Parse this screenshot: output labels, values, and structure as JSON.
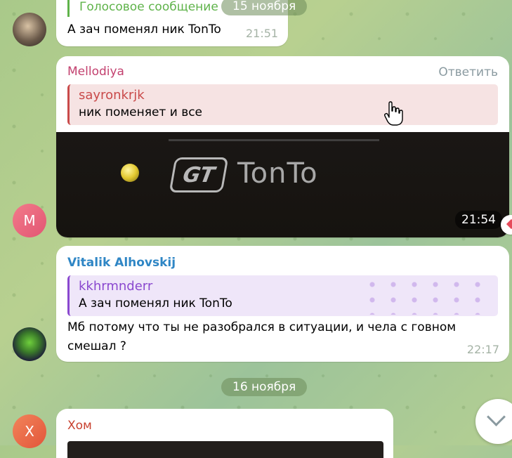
{
  "messages": {
    "prev": {
      "voice_label": "Голосовое сообщение",
      "text": "А зач поменял ник TonTo",
      "time": "21:51"
    },
    "m1": {
      "sender": "Mellodiya",
      "reply_action": "Ответить",
      "reply_name": "sayronkrjk",
      "reply_text": "ник поменяет и все",
      "image_text": "TonTo",
      "image_logo": "GT",
      "time": "21:54",
      "avatar_letter": "M"
    },
    "m2": {
      "sender": "Vitalik Alhovskij",
      "reply_name": "kkhrmnderr",
      "reply_text": "А зач поменял ник TonTo",
      "text_line1": "Мб потому что ты не разобрался в ситуации, и чела с говном",
      "text_line2": "смешал ?",
      "time": "22:17"
    },
    "m3": {
      "sender": "Хом",
      "avatar_letter": "Х"
    }
  },
  "dates": {
    "top": "15 ноября",
    "mid": "16 ноября"
  },
  "colors": {
    "mellodiya": "#c3416f",
    "vitalik": "#2f86c5",
    "hom": "#c8412f",
    "reply_red": "#c94a4a",
    "reply_purple": "#8a48cf",
    "voice_green": "#5fb34a"
  },
  "icons": {
    "scroll_down": "chevron-down-icon",
    "cursor": "hand-cursor-icon"
  }
}
